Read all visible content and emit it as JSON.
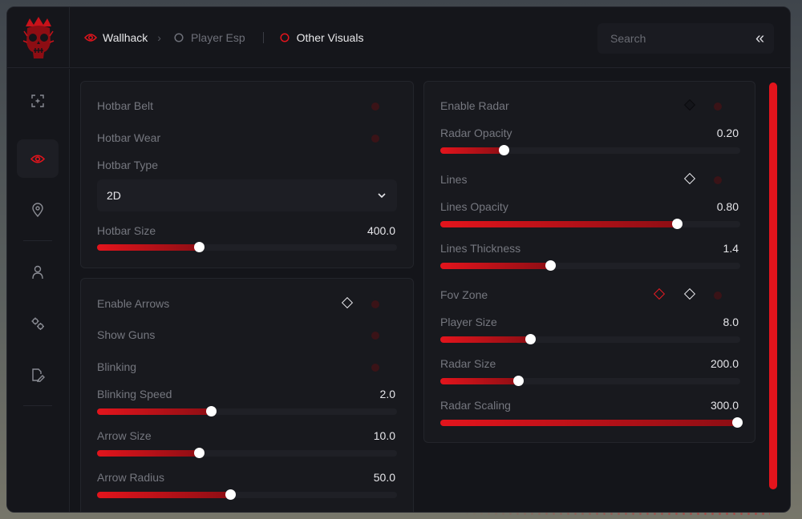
{
  "nav": {
    "wallhack": "Wallhack",
    "player_esp": "Player Esp",
    "other_visuals": "Other Visuals"
  },
  "search": {
    "placeholder": "Search"
  },
  "colors": {
    "accent": "#e3141c",
    "bg": "#14151a",
    "panel": "#18191e"
  },
  "panel_hotbar": {
    "hotbar_belt": "Hotbar Belt",
    "hotbar_wear": "Hotbar Wear",
    "hotbar_type": "Hotbar Type",
    "hotbar_type_value": "2D",
    "hotbar_size": "Hotbar Size",
    "hotbar_size_value": "400.0",
    "hotbar_size_fraction": 0.34
  },
  "panel_arrows": {
    "enable_arrows": "Enable Arrows",
    "show_guns": "Show Guns",
    "blinking": "Blinking",
    "blinking_speed": "Blinking Speed",
    "blinking_speed_value": "2.0",
    "blinking_speed_fraction": 0.38,
    "arrow_size": "Arrow Size",
    "arrow_size_value": "10.0",
    "arrow_size_fraction": 0.34,
    "arrow_radius": "Arrow Radius",
    "arrow_radius_value": "50.0",
    "arrow_radius_fraction": 0.445
  },
  "panel_radar": {
    "enable_radar": "Enable Radar",
    "radar_opacity": "Radar Opacity",
    "radar_opacity_value": "0.20",
    "radar_opacity_fraction": 0.21,
    "lines": "Lines",
    "lines_opacity": "Lines Opacity",
    "lines_opacity_value": "0.80",
    "lines_opacity_fraction": 0.79,
    "lines_thickness": "Lines Thickness",
    "lines_thickness_value": "1.4",
    "lines_thickness_fraction": 0.365,
    "fov_zone": "Fov Zone",
    "player_size": "Player Size",
    "player_size_value": "8.0",
    "player_size_fraction": 0.3,
    "radar_size": "Radar Size",
    "radar_size_value": "200.0",
    "radar_size_fraction": 0.26,
    "radar_scaling": "Radar Scaling",
    "radar_scaling_value": "300.0",
    "radar_scaling_fraction": 0.99
  }
}
